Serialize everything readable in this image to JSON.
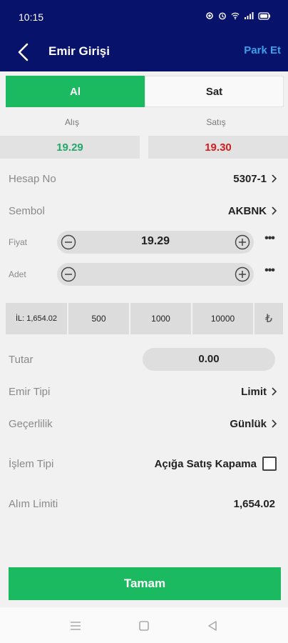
{
  "status": {
    "time": "10:15",
    "icons": [
      "data-saver-icon",
      "alarm-icon",
      "wifi-icon",
      "signal-icon",
      "battery-icon"
    ]
  },
  "header": {
    "title": "Emir Girişi",
    "park": "Park Et"
  },
  "tabs": {
    "buy": "Al",
    "sell": "Sat"
  },
  "prices": {
    "bid_label": "Alış",
    "ask_label": "Satış",
    "bid": "19.29",
    "ask": "19.30",
    "bid_color": "#22a86a",
    "ask_color": "#d81b1b"
  },
  "form": {
    "account_label": "Hesap No",
    "account": "5307-1",
    "symbol_label": "Sembol",
    "symbol": "AKBNK",
    "price_label": "Fiyat",
    "price": "19.29",
    "qty_label": "Adet",
    "qty": "",
    "more": "•••"
  },
  "quick_qty": {
    "limit": "İL: 1,654.02",
    "b1": "500",
    "b2": "1000",
    "b3": "10000",
    "currency": "₺"
  },
  "amount": {
    "label": "Tutar",
    "value": "0.00"
  },
  "order_type": {
    "label": "Emir Tipi",
    "value": "Limit"
  },
  "validity": {
    "label": "Geçerlilik",
    "value": "Günlük"
  },
  "transaction": {
    "label": "İşlem Tipi",
    "value": "Açığa Satış Kapama",
    "checked": false
  },
  "limit": {
    "label": "Alım Limiti",
    "value": "1,654.02"
  },
  "confirm": "Tamam",
  "colors": {
    "header_bg": "#07126b",
    "accent_green": "#1cba60",
    "link_blue": "#3e9ee8"
  }
}
